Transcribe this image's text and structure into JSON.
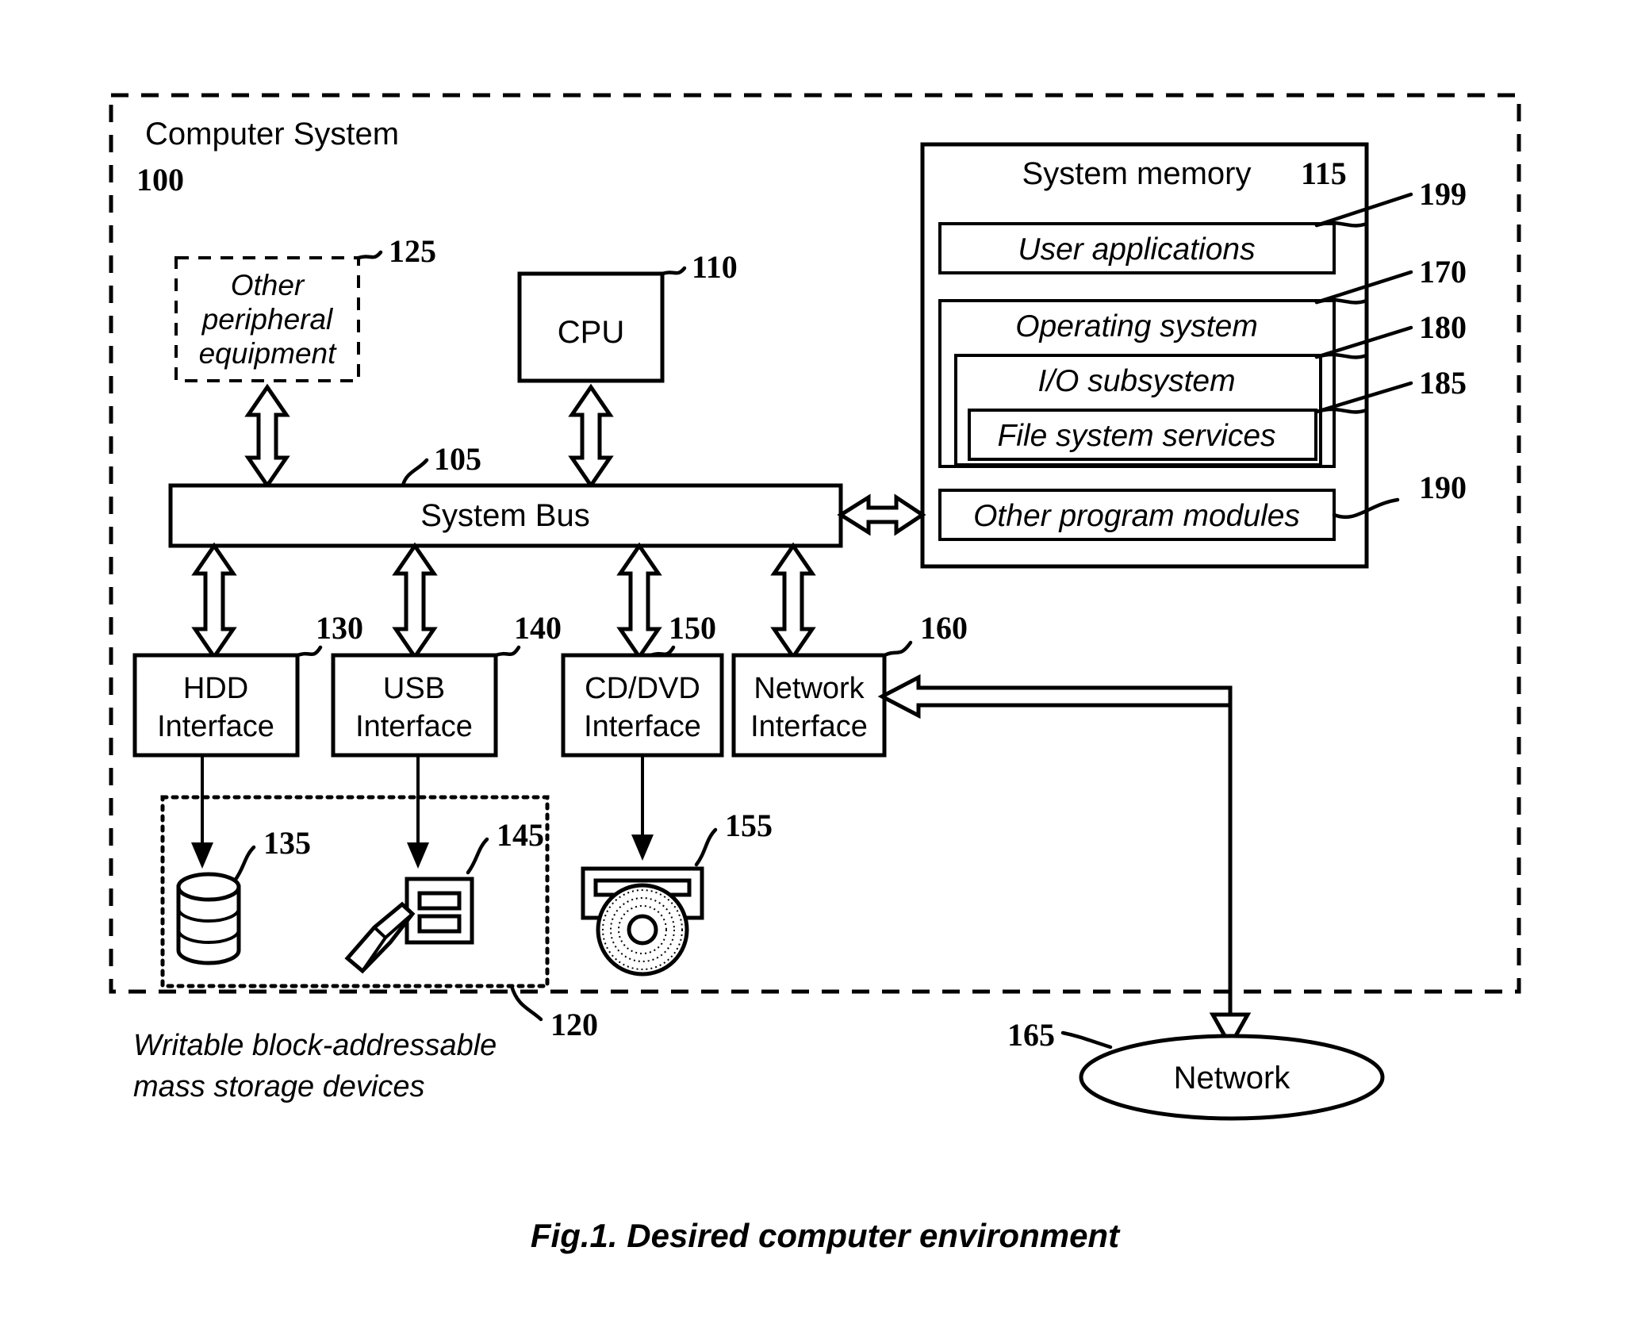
{
  "figure": {
    "caption": "Fig.1. Desired computer environment",
    "outer_label": "Computer System",
    "outer_ref": "100"
  },
  "blocks": {
    "peripheral": {
      "line1": "Other",
      "line2": "peripheral",
      "line3": "equipment",
      "ref": "125"
    },
    "cpu": {
      "label": "CPU",
      "ref": "110"
    },
    "system_bus": {
      "label": "System Bus",
      "ref": "105"
    },
    "system_memory": {
      "label": "System memory",
      "ref": "115"
    },
    "user_applications": {
      "label": "User applications",
      "ref": "199"
    },
    "operating_system": {
      "label": "Operating system",
      "ref": "170"
    },
    "io_subsystem": {
      "label": "I/O subsystem",
      "ref": "180"
    },
    "file_system_services": {
      "label": "File system services",
      "ref": "185"
    },
    "other_program_modules": {
      "label": "Other program modules",
      "ref": "190"
    }
  },
  "interfaces": [
    {
      "line1": "HDD",
      "line2": "Interface",
      "ref": "130"
    },
    {
      "line1": "USB",
      "line2": "Interface",
      "ref": "140"
    },
    {
      "line1": "CD/DVD",
      "line2": "Interface",
      "ref": "150"
    },
    {
      "line1": "Network",
      "line2": "Interface",
      "ref": "160"
    }
  ],
  "devices": {
    "hdd": {
      "ref": "135"
    },
    "usb": {
      "ref": "145"
    },
    "cddvd": {
      "ref": "155"
    },
    "group": {
      "ref": "120",
      "caption_line1": "Writable block-addressable",
      "caption_line2": "mass storage devices"
    }
  },
  "network": {
    "label": "Network",
    "ref": "165"
  },
  "colors": {
    "ink": "#000000",
    "paper": "#ffffff"
  }
}
